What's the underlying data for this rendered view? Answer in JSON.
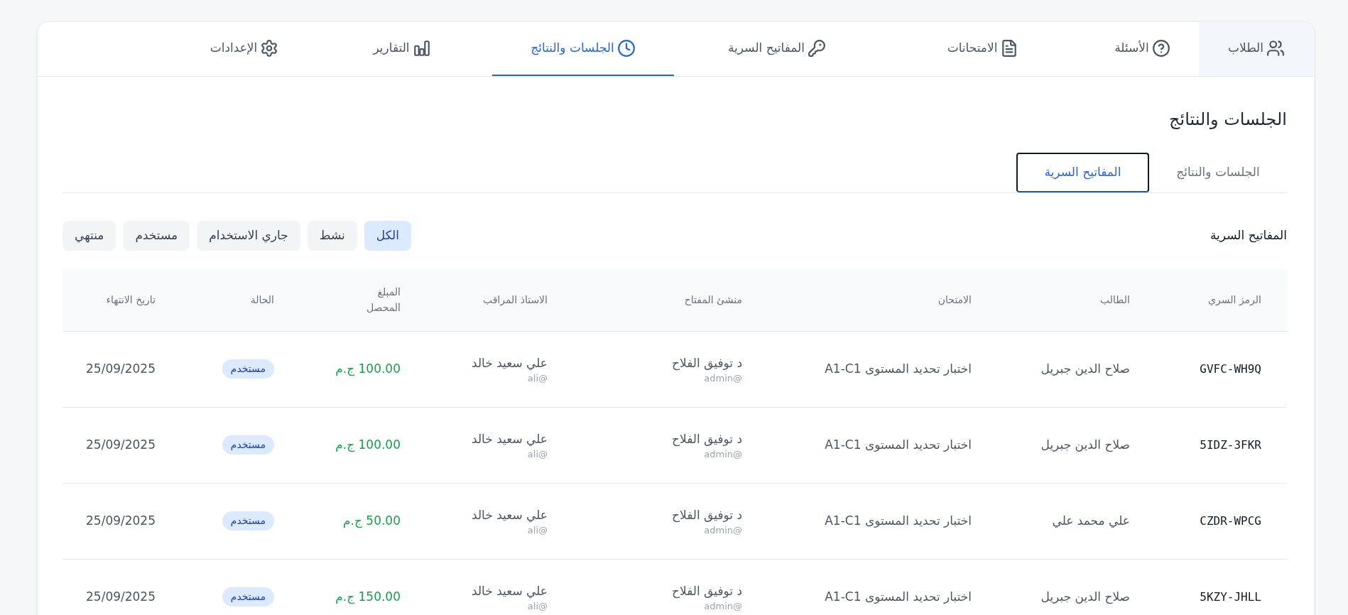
{
  "nav_tabs": [
    {
      "label": "الطلاب",
      "selected": false,
      "hovered": true
    },
    {
      "label": "الأسئلة",
      "selected": false,
      "hovered": false
    },
    {
      "label": "الامتحانات",
      "selected": false,
      "hovered": false
    },
    {
      "label": "المفاتيح السرية",
      "selected": false,
      "hovered": false
    },
    {
      "label": "الجلسات والنتائج",
      "selected": true,
      "hovered": false
    },
    {
      "label": "التقارير",
      "selected": false,
      "hovered": false
    },
    {
      "label": "الإعدادات",
      "selected": false,
      "hovered": false
    }
  ],
  "page_title": "الجلسات والنتائج",
  "sub_tabs": [
    {
      "label": "الجلسات والنتائج",
      "selected": false
    },
    {
      "label": "المفاتيح السرية",
      "selected": true
    }
  ],
  "section_title": "المفاتيح السرية",
  "filters": [
    {
      "label": "الكل",
      "selected": true
    },
    {
      "label": "نشط",
      "selected": false
    },
    {
      "label": "جاري الاستخدام",
      "selected": false
    },
    {
      "label": "مستخدم",
      "selected": false
    },
    {
      "label": "منتهي",
      "selected": false
    }
  ],
  "table": {
    "columns": [
      "الرمز السري",
      "الطالب",
      "الامتحان",
      "منشئ المفتاح",
      "الاستاذ المراقب",
      "المبلغ المحصل",
      "الحالة",
      "تاريخ الانتهاء"
    ],
    "rows": [
      {
        "code": "GVFC-WH9Q",
        "student": "صلاح الدين جبريل",
        "exam": "اختبار تحديد المستوى A1-C1",
        "creator": {
          "name": "د توفيق الفلاح",
          "username": "@admin"
        },
        "proctor": {
          "name": "علي سعيد خالد",
          "username": "@ali"
        },
        "amount": "100.00 ج.م",
        "status": "مستخدم",
        "expires": "25/09/2025"
      },
      {
        "code": "5IDZ-3FKR",
        "student": "صلاح الدين جبريل",
        "exam": "اختبار تحديد المستوى A1-C1",
        "creator": {
          "name": "د توفيق الفلاح",
          "username": "@admin"
        },
        "proctor": {
          "name": "علي سعيد خالد",
          "username": "@ali"
        },
        "amount": "100.00 ج.م",
        "status": "مستخدم",
        "expires": "25/09/2025"
      },
      {
        "code": "CZDR-WPCG",
        "student": "علي محمد علي",
        "exam": "اختبار تحديد المستوى A1-C1",
        "creator": {
          "name": "د توفيق الفلاح",
          "username": "@admin"
        },
        "proctor": {
          "name": "علي سعيد خالد",
          "username": "@ali"
        },
        "amount": "50.00 ج.م",
        "status": "مستخدم",
        "expires": "25/09/2025"
      },
      {
        "code": "5KZY-JHLL",
        "student": "صلاح الدين جبريل",
        "exam": "اختبار تحديد المستوى A1-C1",
        "creator": {
          "name": "د توفيق الفلاح",
          "username": "@admin"
        },
        "proctor": {
          "name": "علي سعيد خالد",
          "username": "@ali"
        },
        "amount": "150.00 ج.م",
        "status": "مستخدم",
        "expires": "25/09/2025"
      }
    ]
  }
}
